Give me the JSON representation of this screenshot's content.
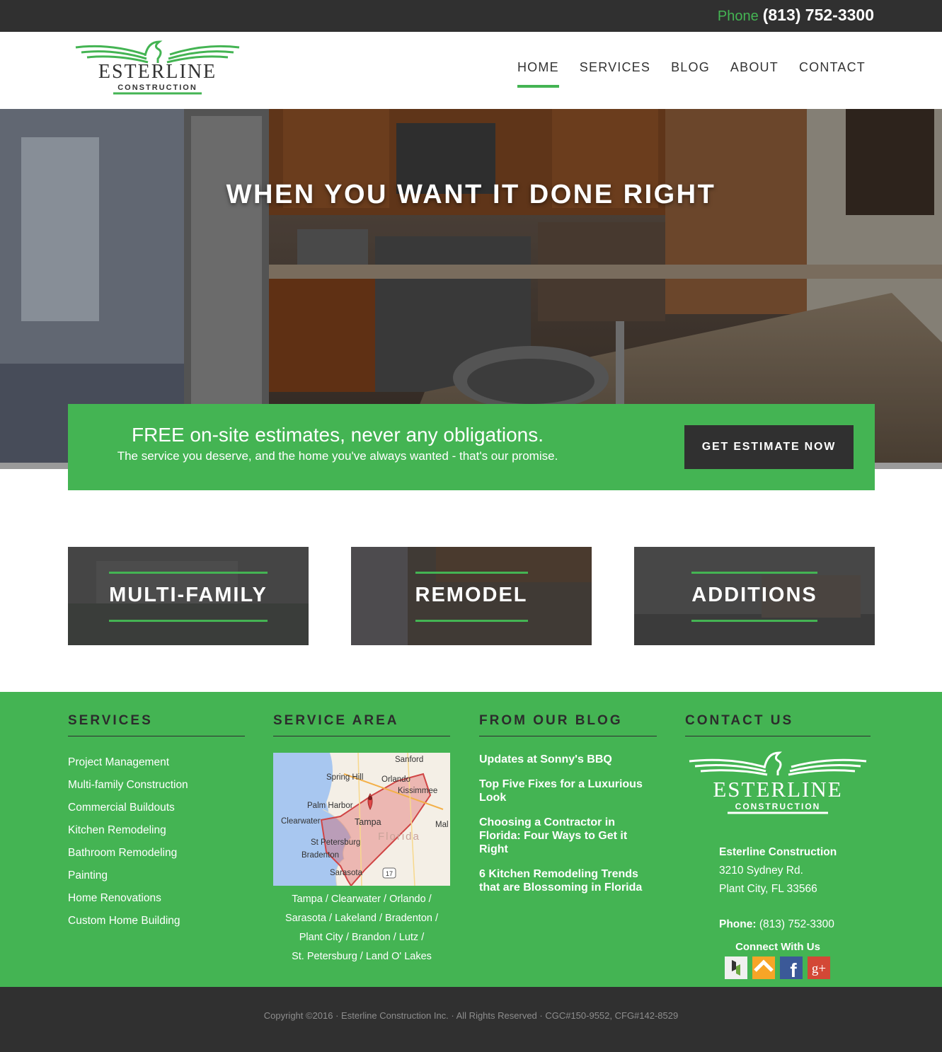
{
  "topbar": {
    "phone_label": "Phone",
    "phone_number": "(813) 752-3300"
  },
  "logo": {
    "name": "ESTERLINE",
    "sub": "CONSTRUCTION"
  },
  "nav": [
    {
      "label": "HOME",
      "active": true
    },
    {
      "label": "SERVICES"
    },
    {
      "label": "BLOG"
    },
    {
      "label": "ABOUT"
    },
    {
      "label": "CONTACT"
    }
  ],
  "hero": {
    "title": "WHEN YOU WANT IT DONE RIGHT"
  },
  "estimate": {
    "headline": "FREE on-site estimates, never any obligations.",
    "subline": "The service you deserve, and the home you've always wanted - that's our promise.",
    "button": "GET ESTIMATE NOW"
  },
  "tiles": [
    "MULTI-FAMILY",
    "REMODEL",
    "ADDITIONS"
  ],
  "footer": {
    "services": {
      "title": "SERVICES",
      "items": [
        "Project Management",
        "Multi-family Construction",
        "Commercial Buildouts",
        "Kitchen Remodeling",
        "Bathroom Remodeling",
        "Painting",
        "Home Renovations",
        "Custom Home Building"
      ]
    },
    "service_area": {
      "title": "SERVICE AREA",
      "map_labels": [
        "Sanford",
        "Spring Hill",
        "Orlando",
        "Kissimmee",
        "Palm Harbor",
        "Tampa",
        "Clearwater",
        "Mal",
        "St Petersburg",
        "Florida",
        "Bradenton",
        "Sarasota",
        "17"
      ],
      "areas": [
        "Tampa / Clearwater / Orlando /",
        "Sarasota / Lakeland / Bradenton /",
        "Plant City / Brandon / Lutz /",
        "St. Petersburg / Land O' Lakes"
      ]
    },
    "blog": {
      "title": "FROM OUR BLOG",
      "posts": [
        "Updates at Sonny's BBQ",
        "Top Five Fixes for a Luxurious Look",
        "Choosing a Contractor in Florida: Four Ways to Get it Right",
        "6 Kitchen Remodeling Trends that are Blossoming in Florida"
      ]
    },
    "contact": {
      "title": "CONTACT US",
      "company": "Esterline Construction",
      "street": "3210 Sydney Rd.",
      "city": "Plant City, FL 33566",
      "phone_label": "Phone:",
      "phone": "(813) 752-3300",
      "connect": "Connect With Us",
      "social_icons": [
        "houzz-icon",
        "homeadvisor-icon",
        "facebook-icon",
        "googleplus-icon"
      ]
    }
  },
  "copyright": "Copyright ©2016 · Esterline Construction Inc. · All Rights Reserved · CGC#150-9552, CFG#142-8529",
  "colors": {
    "accent": "#44b453",
    "dark": "#303030"
  }
}
